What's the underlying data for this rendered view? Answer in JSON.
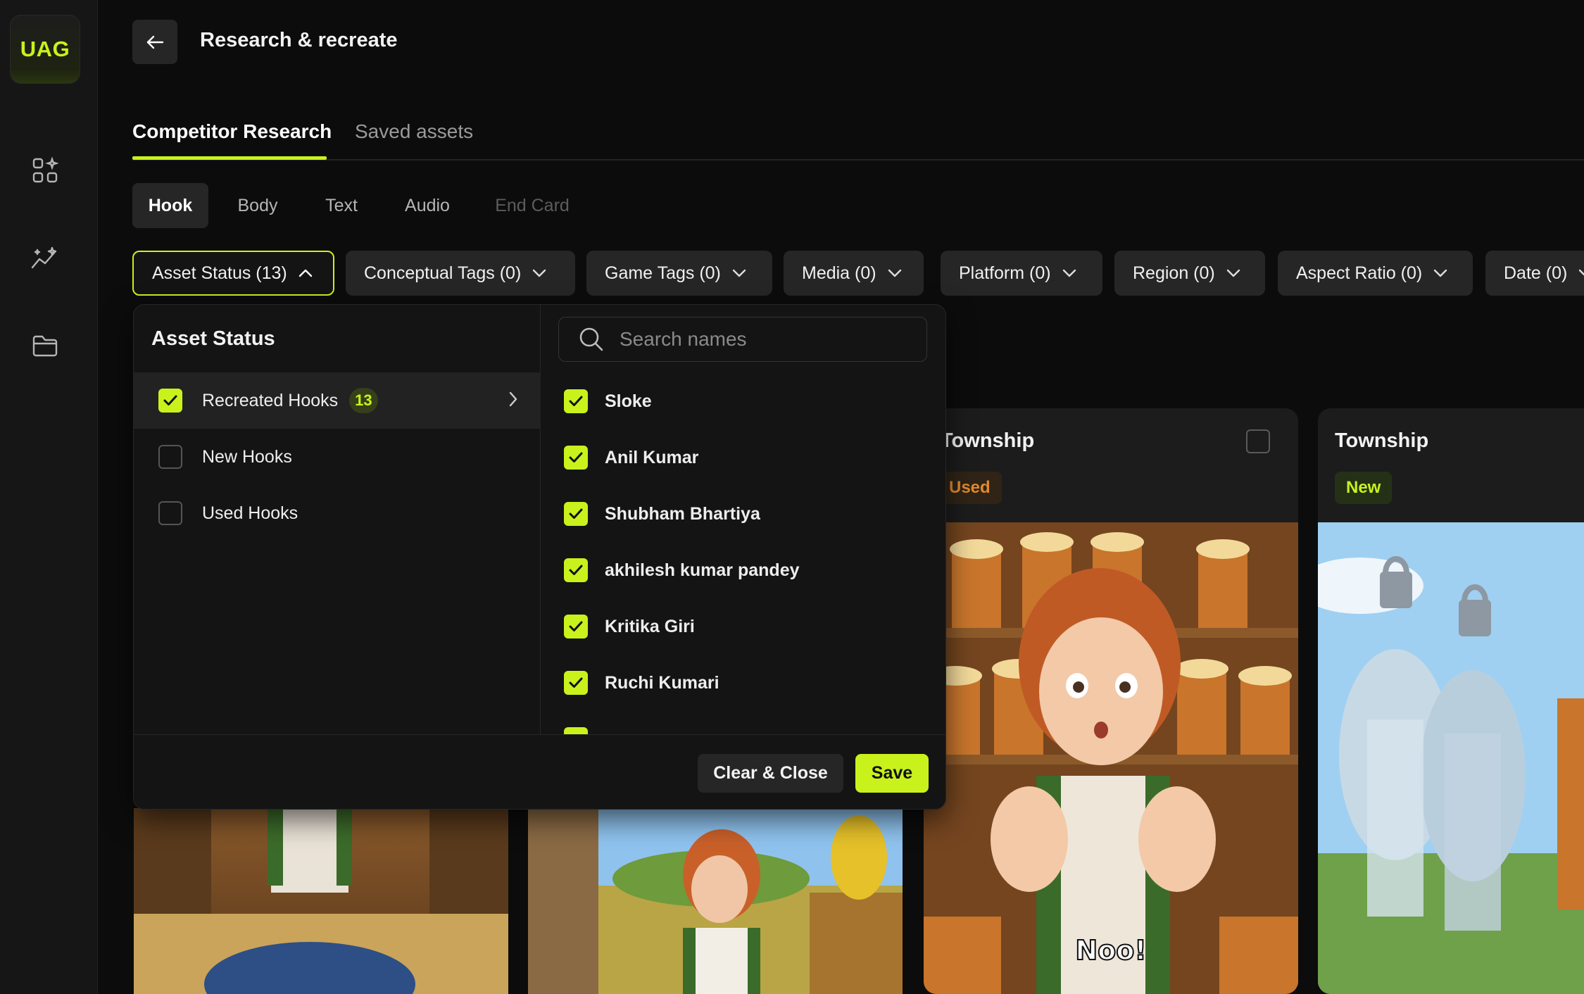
{
  "app": {
    "logo": "UAG"
  },
  "header": {
    "title": "Research & recreate",
    "back_icon": "arrow-left-icon"
  },
  "sidebar": {
    "items": [
      {
        "icon": "apps-sparkle-icon"
      },
      {
        "icon": "analytics-sparkle-icon"
      },
      {
        "icon": "folder-icon"
      }
    ]
  },
  "tabs": [
    "Competitor Research",
    "Saved assets"
  ],
  "subtabs": [
    "Hook",
    "Body",
    "Text",
    "Audio",
    "End Card"
  ],
  "filters": [
    "Asset Status (13)",
    "Conceptual Tags (0)",
    "Game Tags (0)",
    "Media (0)",
    "Platform (0)",
    "Region (0)",
    "Aspect Ratio (0)",
    "Date (0)"
  ],
  "panel": {
    "title": "Asset Status",
    "statuses": [
      {
        "label": "Recreated Hooks",
        "count": "13",
        "checked": true
      },
      {
        "label": "New Hooks",
        "checked": false
      },
      {
        "label": "Used Hooks",
        "checked": false
      }
    ],
    "search_placeholder": "Search names",
    "names": [
      "Sloke",
      "Anil Kumar",
      "Shubham Bhartiya",
      "akhilesh kumar pandey",
      "Kritika Giri",
      "Ruchi Kumari"
    ],
    "clear_label": "Clear & Close",
    "save_label": "Save"
  },
  "cards": [
    {
      "title": "Township",
      "badge": "Used",
      "caption": "Noo!"
    },
    {
      "title": "Township",
      "badge": "New"
    }
  ],
  "colors": {
    "accent": "#c9f21c",
    "used": "#e2892c"
  }
}
